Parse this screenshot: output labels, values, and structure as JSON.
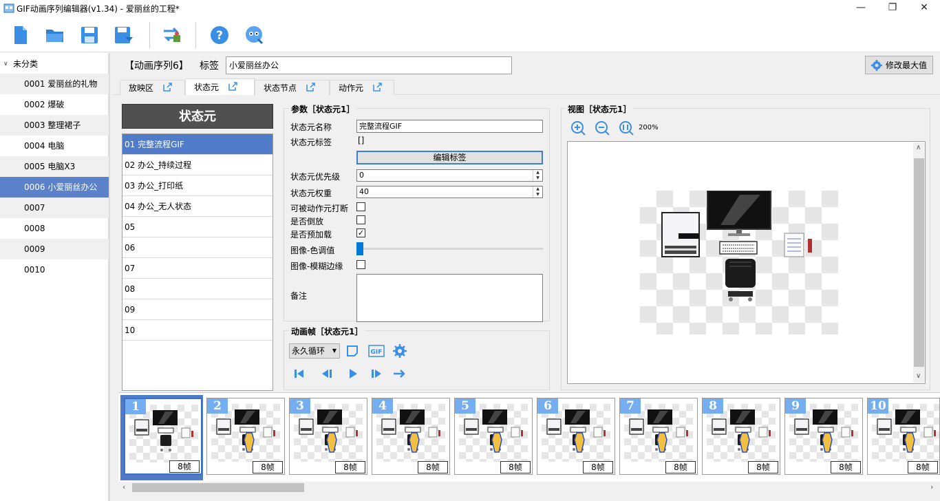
{
  "window": {
    "title": "GIF动画序列编辑器(v1.34) - 爱丽丝的工程*",
    "minimize": "—",
    "maximize": "❐",
    "close": "✕"
  },
  "toolbar": {
    "icons": [
      "new-file-icon",
      "open-folder-icon",
      "save-icon",
      "save-as-icon",
      "convert-icon",
      "help-icon",
      "about-icon"
    ]
  },
  "tree": {
    "root": "未分类",
    "items": [
      {
        "label": "0001 爱丽丝的礼物"
      },
      {
        "label": "0002 爆破"
      },
      {
        "label": "0003 整理裙子"
      },
      {
        "label": "0004 电脑"
      },
      {
        "label": "0005 电脑X3"
      },
      {
        "label": "0006 小爱丽丝办公"
      },
      {
        "label": "0007"
      },
      {
        "label": "0008"
      },
      {
        "label": "0009"
      },
      {
        "label": "0010"
      }
    ],
    "selected_index": 5
  },
  "header": {
    "sequence": "【动画序列6】",
    "tag_label": "标签",
    "tag_value": "小爱丽丝办公",
    "max_button": "修改最大值"
  },
  "tabs": [
    {
      "label": "放映区"
    },
    {
      "label": "状态元"
    },
    {
      "label": "状态节点"
    },
    {
      "label": "动作元"
    }
  ],
  "active_tab": 1,
  "state_panel": {
    "title": "状态元",
    "rows": [
      "01 完整流程GIF",
      "02 办公_持续过程",
      "03 办公_打印纸",
      "04 办公_无人状态",
      "05",
      "06",
      "07",
      "08",
      "09",
      "10"
    ]
  },
  "params": {
    "title": "参数［状态元1］",
    "name_label": "状态元名称",
    "name_value": "完整流程GIF",
    "tag_label": "状态元标签",
    "tag_value": "[]",
    "edit_tag_button": "编辑标签",
    "priority_label": "状态元优先级",
    "priority_value": "0",
    "weight_label": "状态元权重",
    "weight_value": "40",
    "interruptible_label": "可被动作元打断",
    "interruptible": false,
    "reverse_label": "是否倒放",
    "reverse": false,
    "preload_label": "是否预加载",
    "preload": true,
    "hue_label": "图像-色调值",
    "hue_value": 0,
    "blur_label": "图像-模糊边缘",
    "blur": false,
    "notes_label": "备注",
    "notes_value": ""
  },
  "anim": {
    "title": "动画帧［状态元1］",
    "loop_mode": "永久循环"
  },
  "view": {
    "title": "视图［状态元1］",
    "zoom": "200%"
  },
  "frames": [
    {
      "num": "1",
      "count": "8帧"
    },
    {
      "num": "2",
      "count": "8帧"
    },
    {
      "num": "3",
      "count": "8帧"
    },
    {
      "num": "4",
      "count": "8帧"
    },
    {
      "num": "5",
      "count": "8帧"
    },
    {
      "num": "6",
      "count": "8帧"
    },
    {
      "num": "7",
      "count": "8帧"
    },
    {
      "num": "8",
      "count": "8帧"
    },
    {
      "num": "9",
      "count": "8帧"
    },
    {
      "num": "10",
      "count": "8帧"
    }
  ],
  "colors": {
    "accent": "#4f7bc8",
    "frame_badge": "#74aef0",
    "icon_blue": "#3a8ee6"
  }
}
